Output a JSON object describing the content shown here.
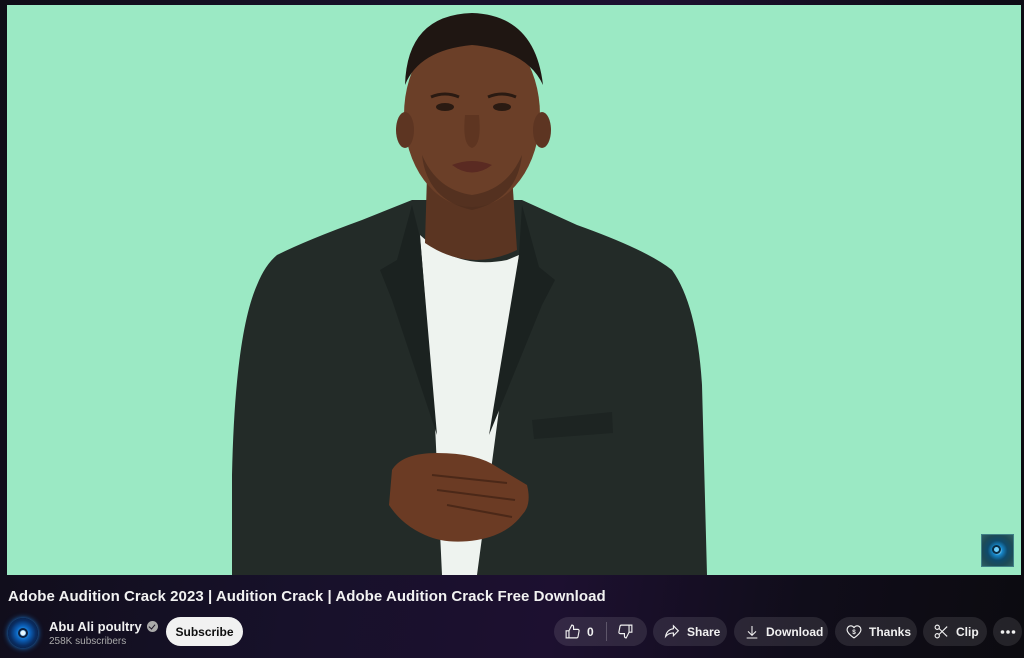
{
  "video": {
    "scene_description": "Presenter in dark blazer and white t-shirt against mint green background",
    "background_color": "#9be9c4",
    "watermark_icon": "channel-logo-icon"
  },
  "title": "Adobe Audition Crack 2023 | Audition Crack | Adobe Audition Crack Free Download",
  "channel": {
    "name": "Abu Ali poultry",
    "verified": true,
    "subscribers": "258K subscribers",
    "avatar_icon": "channel-avatar-icon"
  },
  "actions": {
    "subscribe": "Subscribe",
    "like_count": "0",
    "share": "Share",
    "download": "Download",
    "thanks": "Thanks",
    "clip": "Clip",
    "more": "More actions"
  },
  "colors": {
    "page_bg_dark": "#0f0d17",
    "page_bg_purple": "#1d1030",
    "button_bg": "rgba(255,255,255,0.1)",
    "subscribe_bg": "#f1f1f1",
    "text_primary": "#f1f1f1",
    "text_secondary": "#aaaaaa"
  }
}
